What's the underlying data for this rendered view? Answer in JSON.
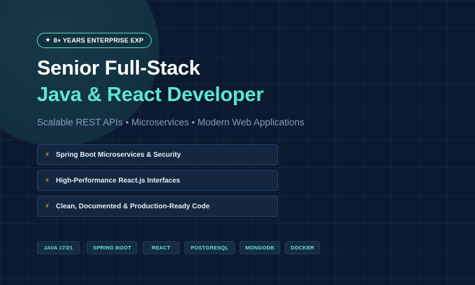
{
  "badge": {
    "icon": "star-icon",
    "star_glyph": "★",
    "label": "8+ YEARS ENTERPRISE EXP"
  },
  "headline": {
    "line1": "Senior Full-Stack",
    "line2": "Java & React Developer"
  },
  "subtitle": "Scalable REST APIs • Microservices • Modern Web Applications",
  "features": [
    {
      "icon": "lightning-icon",
      "glyph": "⚡",
      "text": "Spring Boot Microservices & Security"
    },
    {
      "icon": "lightning-icon",
      "glyph": "⚡",
      "text": "High-Performance React.js Interfaces"
    },
    {
      "icon": "lightning-icon",
      "glyph": "⚡",
      "text": "Clean, Documented & Production-Ready Code"
    }
  ],
  "tech_tags": [
    "JAVA 17/21",
    "SPRING BOOT",
    "REACT",
    "POSTGRESQL",
    "MONGODB",
    "DOCKER"
  ],
  "colors": {
    "background": "#0b1a30",
    "accent": "#5ee6cf",
    "bolt": "#f5c542",
    "subtitle": "#8a9bb5"
  }
}
